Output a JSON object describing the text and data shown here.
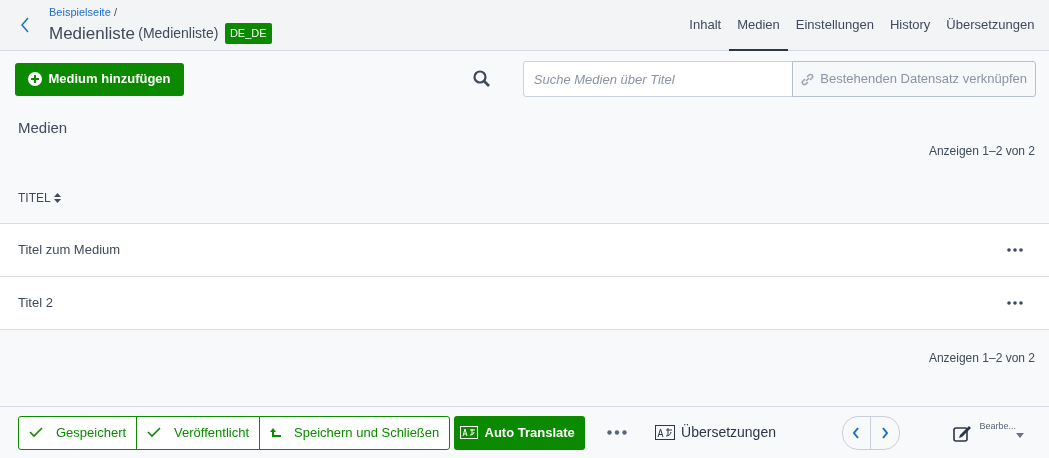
{
  "header": {
    "breadcrumb": "Beispielseite",
    "breadcrumb_separator": "/",
    "title": "Medienliste",
    "subtitle": "(Medienliste)",
    "locale_badge": "DE_DE"
  },
  "tabs": [
    {
      "label": "Inhalt",
      "selected": false
    },
    {
      "label": "Medien",
      "selected": true
    },
    {
      "label": "Einstellungen",
      "selected": false
    },
    {
      "label": "History",
      "selected": false
    },
    {
      "label": "Übersetzungen",
      "selected": false
    }
  ],
  "toolbar": {
    "add_button": "Medium hinzufügen",
    "search": {
      "placeholder": "Suche Medien über Titel"
    },
    "link_button": "Bestehenden Datensatz verknüpfen"
  },
  "section_title": "Medien",
  "pagination_top": "Anzeigen 1–2 von 2",
  "table": {
    "columns": [
      {
        "label": "TITEL",
        "sortable": true
      }
    ],
    "rows": [
      {
        "title": "Titel zum Medium"
      },
      {
        "title": "Titel 2"
      }
    ]
  },
  "pagination_bottom": "Anzeigen 1–2 von 2",
  "footer": {
    "status_buttons": [
      {
        "label": "Gespeichert",
        "kind": "check"
      },
      {
        "label": "Veröffentlicht",
        "kind": "check"
      },
      {
        "label": "Speichern und Schließen",
        "kind": "save-close"
      }
    ],
    "translate_button": "Auto Translate",
    "translations_link": "Übersetzungen",
    "edit_label": "Bearbe..."
  }
}
